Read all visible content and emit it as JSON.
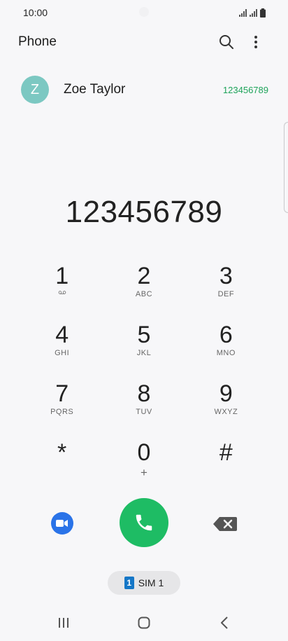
{
  "status_bar": {
    "time": "10:00"
  },
  "header": {
    "title": "Phone",
    "search_icon": "search-icon",
    "more_icon": "more-vert-icon"
  },
  "contact_suggestion": {
    "initial": "Z",
    "name": "Zoe Taylor",
    "number": "123456789"
  },
  "dialed_number": "123456789",
  "keypad": {
    "keys": [
      {
        "digit": "1",
        "letters": ""
      },
      {
        "digit": "2",
        "letters": "ABC"
      },
      {
        "digit": "3",
        "letters": "DEF"
      },
      {
        "digit": "4",
        "letters": "GHI"
      },
      {
        "digit": "5",
        "letters": "JKL"
      },
      {
        "digit": "6",
        "letters": "MNO"
      },
      {
        "digit": "7",
        "letters": "PQRS"
      },
      {
        "digit": "8",
        "letters": "TUV"
      },
      {
        "digit": "9",
        "letters": "WXYZ"
      },
      {
        "digit": "*",
        "letters": ""
      },
      {
        "digit": "0",
        "letters": "+"
      },
      {
        "digit": "#",
        "letters": ""
      }
    ]
  },
  "sim": {
    "badge": "1",
    "label": "SIM 1"
  },
  "colors": {
    "accent_green": "#1ebc64",
    "number_green": "#1ea35a",
    "video_blue": "#2a73e8",
    "avatar_teal": "#7cc8c2"
  }
}
